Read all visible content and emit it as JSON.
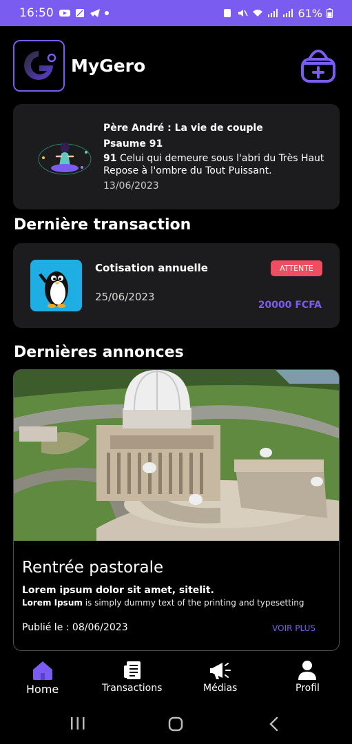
{
  "status_bar": {
    "time": "16:50",
    "battery": "61%"
  },
  "header": {
    "app_title": "MyGero"
  },
  "verse_card": {
    "title": "Père André : La vie de couple",
    "psalm": "Psaume 91",
    "verse_number": "91",
    "verse_text": "Celui qui demeure sous l'abri du Très Haut Repose à l'ombre du Tout Puissant.",
    "date": "13/06/2023"
  },
  "transactions": {
    "section_title": "Dernière transaction",
    "item": {
      "name": "Cotisation annuelle",
      "date": "25/06/2023",
      "status": "ATTENTE",
      "amount": "20000 FCFA"
    }
  },
  "announcements": {
    "section_title": "Dernières annonces",
    "item": {
      "title": "Rentrée pastorale",
      "subtitle": "Lorem ipsum dolor sit amet, sitelit.",
      "desc_bold": "Lorem Ipsum",
      "desc_rest": " is simply dummy text of the printing and typesetting",
      "published": "Publié le : 08/06/2023",
      "more_label": "VOIR PLUS"
    }
  },
  "bottom_nav": {
    "items": [
      {
        "label": "Home",
        "icon": "home-icon",
        "active": true
      },
      {
        "label": "Transactions",
        "icon": "receipt-icon",
        "active": false
      },
      {
        "label": "Médias",
        "icon": "megaphone-icon",
        "active": false
      },
      {
        "label": "Profil",
        "icon": "user-icon",
        "active": false
      }
    ]
  },
  "colors": {
    "accent": "#7b5cf0",
    "status_badge": "#ef4d61",
    "card_bg": "#1c1c1e",
    "background": "#000000"
  }
}
